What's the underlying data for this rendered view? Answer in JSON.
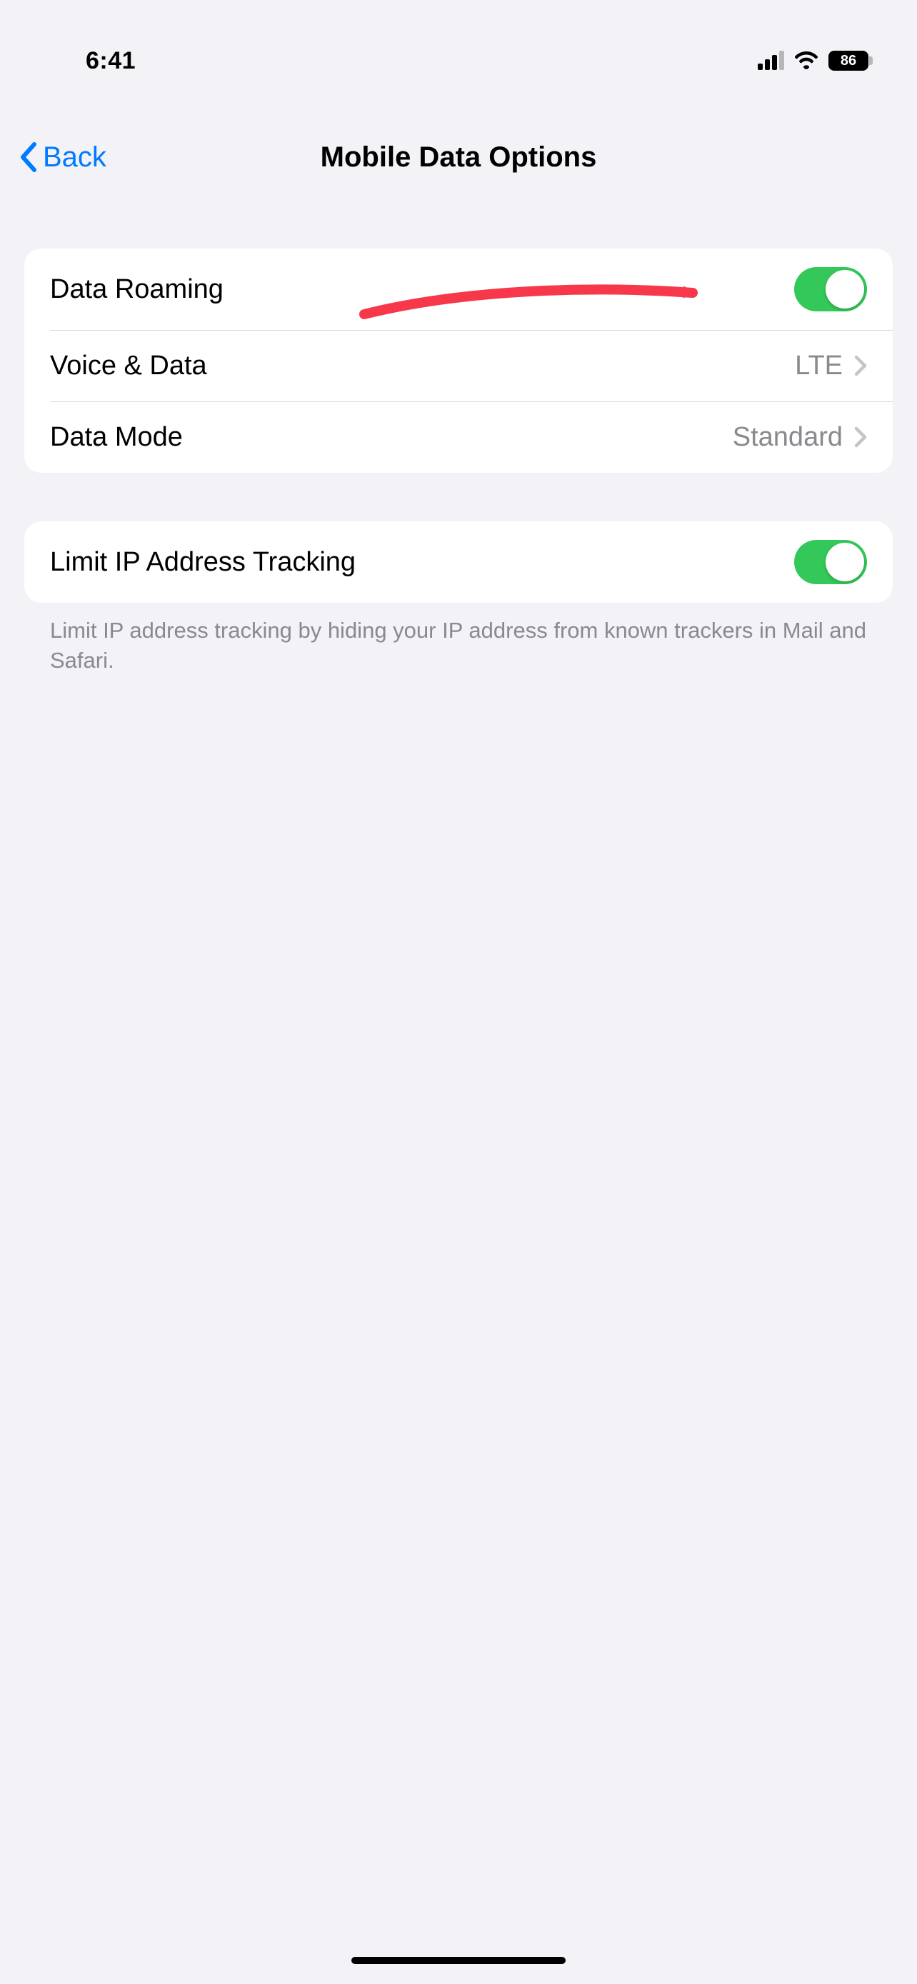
{
  "status": {
    "time": "6:41",
    "battery_percent": "86"
  },
  "nav": {
    "back_label": "Back",
    "title": "Mobile Data Options"
  },
  "group1": {
    "rows": [
      {
        "label": "Data Roaming",
        "type": "toggle",
        "on": true
      },
      {
        "label": "Voice & Data",
        "type": "link",
        "value": "LTE"
      },
      {
        "label": "Data Mode",
        "type": "link",
        "value": "Standard"
      }
    ]
  },
  "group2": {
    "rows": [
      {
        "label": "Limit IP Address Tracking",
        "type": "toggle",
        "on": true
      }
    ],
    "footer": "Limit IP address tracking by hiding your IP address from known trackers in Mail and Safari."
  },
  "colors": {
    "accent": "#007aff",
    "toggle_on": "#34c759",
    "annotation_arrow": "#f7374a"
  }
}
